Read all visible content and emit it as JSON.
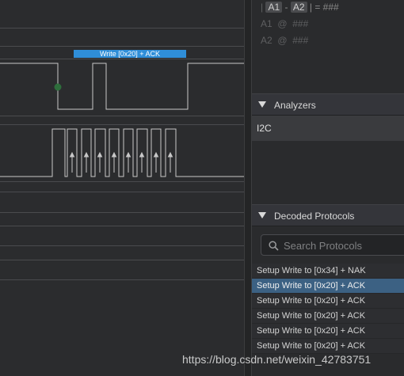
{
  "waveform": {
    "decode_bubble": "Write [0x20] + ACK",
    "colors": {
      "background": "#2b2c2e",
      "signal": "#c8c8c8",
      "bubble": "#2f8ed8",
      "marker": "#2e6e3c"
    }
  },
  "measurement": {
    "delta_row": {
      "bar": "|",
      "a1": "A1",
      "dash": "-",
      "a2": "A2",
      "result": "| = ###"
    },
    "a1_row": {
      "label": "A1",
      "at": "@",
      "value": "###"
    },
    "a2_row": {
      "label": "A2",
      "at": "@",
      "value": "###"
    }
  },
  "analyzers": {
    "title": "Analyzers",
    "items": [
      {
        "label": "I2C"
      }
    ]
  },
  "decoded_protocols": {
    "title": "Decoded Protocols",
    "search_placeholder": "Search Protocols",
    "rows": [
      {
        "label": "Setup Write to [0x34] + NAK",
        "selected": false
      },
      {
        "label": "Setup Write to [0x20] + ACK",
        "selected": true
      },
      {
        "label": "Setup Write to [0x20] + ACK",
        "selected": false
      },
      {
        "label": "Setup Write to [0x20] + ACK",
        "selected": false
      },
      {
        "label": "Setup Write to [0x20] + ACK",
        "selected": false
      },
      {
        "label": "Setup Write to [0x20] + ACK",
        "selected": false
      }
    ]
  },
  "watermark": "https://blog.csdn.net/weixin_42783751"
}
